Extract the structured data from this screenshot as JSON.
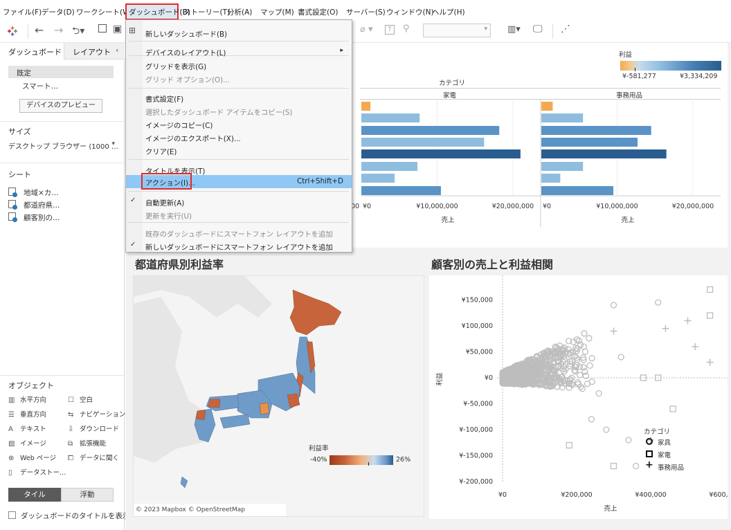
{
  "menubar": {
    "items": [
      "ファイル(F)",
      "データ(D)",
      "ワークシート(W)",
      "ダッシュボード(B)",
      "ストーリー(T)",
      "分析(A)",
      "マップ(M)",
      "書式設定(O)",
      "サーバー(S)",
      "ウィンドウ(N)",
      "ヘルプ(H)"
    ]
  },
  "left": {
    "tab_dashboard": "ダッシュボード",
    "tab_layout": "レイアウト",
    "default_label": "既定",
    "smart_label": "スマート…",
    "preview_button": "デバイスのプレビュー",
    "size_title": "サイズ",
    "size_value": "デスクトップ ブラウザー (1000 …",
    "sheets_title": "シート",
    "sheets": [
      "地域×カ…",
      "都道府県…",
      "顧客別の…"
    ],
    "objects_title": "オブジェクト",
    "objects": [
      {
        "icon": "▥",
        "label": "水平方向"
      },
      {
        "icon": "☐",
        "label": "空白"
      },
      {
        "icon": "☰",
        "label": "垂直方向"
      },
      {
        "icon": "⇆",
        "label": "ナビゲーション"
      },
      {
        "icon": "A",
        "label": "テキスト"
      },
      {
        "icon": "⇩",
        "label": "ダウンロード"
      },
      {
        "icon": "▨",
        "label": "イメージ"
      },
      {
        "icon": "⧉",
        "label": "拡張機能"
      },
      {
        "icon": "⊕",
        "label": "Web ページ"
      },
      {
        "icon": "⧠",
        "label": "データに聞く"
      },
      {
        "icon": "▯",
        "label": "データストー…"
      }
    ],
    "tile_button": "タイル",
    "float_button": "浮動",
    "show_title_checkbox": "ダッシュボードのタイトルを表示"
  },
  "dropdown": {
    "items": [
      {
        "label": "新しいダッシュボード(B)",
        "enabled": true
      },
      {
        "label": "デバイスのレイアウト(L)",
        "enabled": true,
        "submenu": true
      },
      {
        "label": "グリッドを表示(G)",
        "enabled": true
      },
      {
        "label": "グリッド オプション(O)...",
        "enabled": false
      },
      {
        "label": "書式設定(F)",
        "enabled": true
      },
      {
        "label": "選択したダッシュボード アイテムをコピー(S)",
        "enabled": false
      },
      {
        "label": "イメージのコピー(C)",
        "enabled": true
      },
      {
        "label": "イメージのエクスポート(X)...",
        "enabled": true
      },
      {
        "label": "クリア(E)",
        "enabled": true
      },
      {
        "label": "タイトルを表示(T)",
        "enabled": true
      },
      {
        "label": "アクション(I)...",
        "enabled": true,
        "shortcut": "Ctrl+Shift+D",
        "highlighted": true
      },
      {
        "label": "自動更新(A)",
        "enabled": true,
        "checked": true
      },
      {
        "label": "更新を実行(U)",
        "enabled": false
      },
      {
        "label": "既存のダッシュボードにスマートフォン レイアウトを追加",
        "enabled": false
      },
      {
        "label": "新しいダッシュボードにスマートフォン レイアウトを追加",
        "enabled": true,
        "checked": true
      }
    ]
  },
  "barchart": {
    "legend_title": "利益",
    "legend_min": "¥-581,277",
    "legend_max": "¥3,334,209",
    "category_header": "カテゴリ",
    "panels": [
      "家電",
      "事務用品"
    ],
    "xlabel": "売上",
    "ticks": [
      "¥0",
      "¥10,000,000",
      "¥20,000,000"
    ],
    "partial_tick": "00"
  },
  "map": {
    "title": "都道府県別利益率",
    "legend_title": "利益率",
    "legend_min": "-40%",
    "legend_max": "26%",
    "credit": "© 2023 Mapbox © OpenStreetMap"
  },
  "scatter": {
    "title": "顧客別の売上と利益相関",
    "ylabel": "利益",
    "xlabel": "売上",
    "yticks": [
      "¥150,000",
      "¥100,000",
      "¥50,000",
      "¥0",
      "¥-50,000",
      "¥-100,000",
      "¥-150,000",
      "¥-200,000"
    ],
    "xticks": [
      "¥0",
      "¥200,000",
      "¥400,000",
      "¥600,000"
    ],
    "legend_title": "カテゴリ",
    "legend": [
      "家具",
      "家電",
      "事務用品"
    ]
  },
  "colors": {
    "highlight": "#90c8f5",
    "red_box": "#e8262a",
    "bar_positive_dark": "#2a5d8f",
    "bar_positive_light": "#8fbde0",
    "bar_negative": "#f5a94f",
    "map_positive": "#6f9bc9",
    "map_negative": "#c8643c"
  },
  "chart_data": {
    "type": "bar",
    "panels": [
      {
        "name": "家電",
        "values": [
          1200000,
          7700000,
          18200000,
          16200000,
          21000000,
          7400000,
          4400000,
          10500000
        ],
        "profit_color": [
          "neg",
          "light",
          "mid",
          "light",
          "dark",
          "light",
          "light",
          "mid"
        ]
      },
      {
        "name": "事務用品",
        "values": [
          1500000,
          5500000,
          14500000,
          12700000,
          16500000,
          5500000,
          2500000,
          9500000
        ],
        "profit_color": [
          "neg",
          "light",
          "mid",
          "mid",
          "dark",
          "light",
          "light",
          "mid"
        ]
      }
    ]
  }
}
